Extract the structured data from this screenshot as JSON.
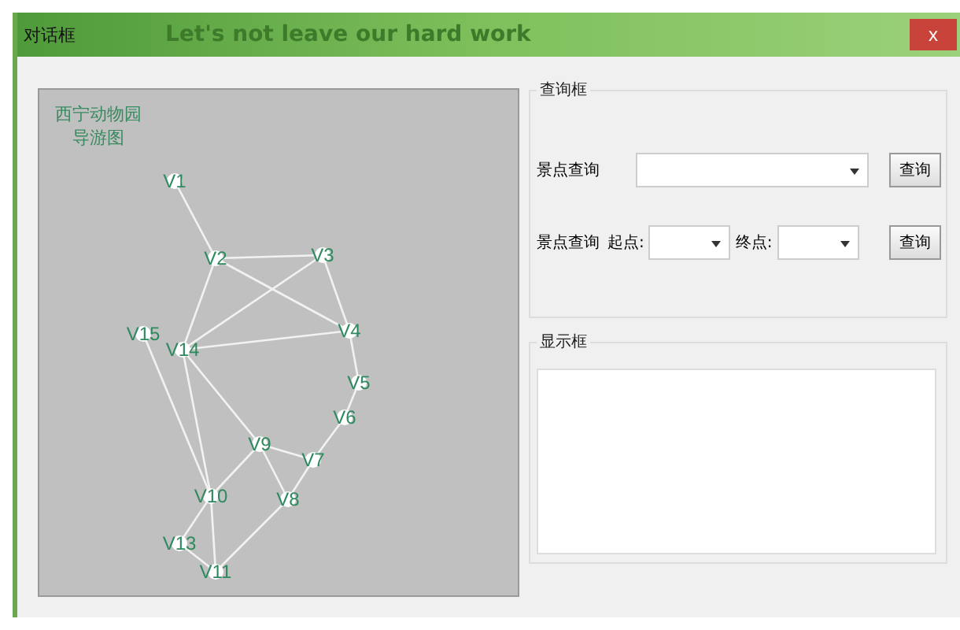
{
  "window": {
    "title": "对话框",
    "banner": "Let's not leave our hard work",
    "close": "x"
  },
  "map": {
    "caption_lines": [
      "西宁动物园",
      "导游图"
    ],
    "nodes": [
      "V1",
      "V3",
      "V2",
      "V4",
      "V15",
      "V14",
      "V5",
      "V6",
      "V9",
      "V7",
      "V10",
      "V8",
      "V13",
      "V11"
    ]
  },
  "query_group": {
    "title": "查询框",
    "spot_query": {
      "label": "景点查询",
      "button": "查询"
    },
    "path_query": {
      "label": "景点查询",
      "start_label": "起点:",
      "end_label": "终点:",
      "button": "查询"
    }
  },
  "display_group": {
    "title": "显示框"
  }
}
